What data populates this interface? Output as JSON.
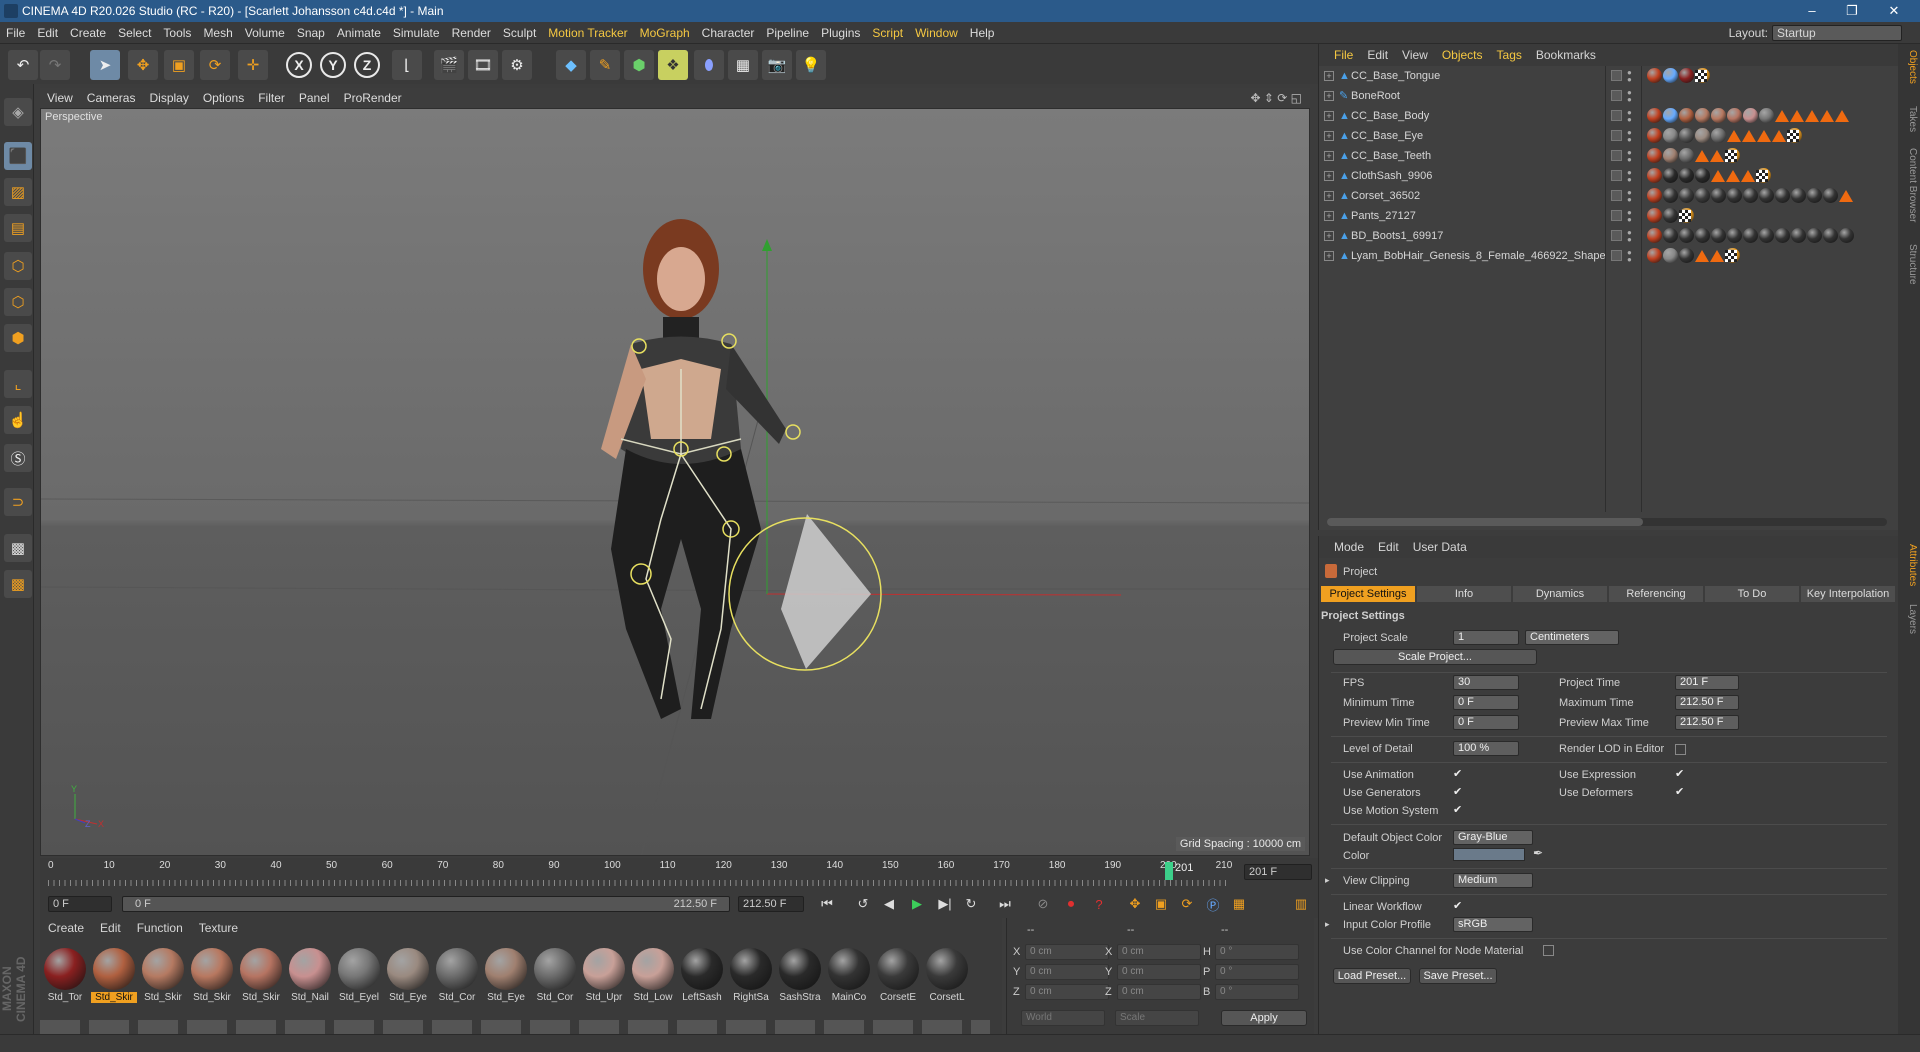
{
  "window": {
    "title": "CINEMA 4D R20.026 Studio (RC - R20) - [Scarlett Johansson c4d.c4d *] - Main"
  },
  "menu": [
    "File",
    "Edit",
    "Create",
    "Select",
    "Tools",
    "Mesh",
    "Volume",
    "Snap",
    "Animate",
    "Simulate",
    "Render",
    "Sculpt",
    "Motion Tracker",
    "MoGraph",
    "Character",
    "Pipeline",
    "Plugins",
    "Script",
    "Window",
    "Help"
  ],
  "layout": {
    "label": "Layout:",
    "value": "Startup"
  },
  "viewport": {
    "menu": [
      "View",
      "Cameras",
      "Display",
      "Options",
      "Filter",
      "Panel",
      "ProRender"
    ],
    "label": "Perspective",
    "grid_spacing": "Grid Spacing : 10000 cm",
    "axis_y": "Y",
    "axis_z": "Z",
    "axis_x": "X"
  },
  "timeline": {
    "ticks": [
      "0",
      "10",
      "20",
      "30",
      "40",
      "50",
      "60",
      "70",
      "80",
      "90",
      "100",
      "110",
      "120",
      "130",
      "140",
      "150",
      "160",
      "170",
      "180",
      "190",
      "200",
      "210"
    ],
    "current_frame": "201 F",
    "playhead_label": "201",
    "start": "0 F",
    "range_start": "0 F",
    "range_end": "212.50 F",
    "end": "212.50 F"
  },
  "materials": {
    "tabs": [
      "Create",
      "Edit",
      "Function",
      "Texture"
    ],
    "items": [
      "Std_Tor",
      "Std_Skir",
      "Std_Skir",
      "Std_Skir",
      "Std_Skir",
      "Std_Nail",
      "Std_Eyel",
      "Std_Eye",
      "Std_Cor",
      "Std_Eye",
      "Std_Cor",
      "Std_Upr",
      "Std_Low",
      "LeftSash",
      "RightSa",
      "SashStra",
      "MainCo",
      "CorsetE",
      "CorsetL"
    ],
    "colors": [
      "#8a2020",
      "#b06040",
      "#b57a62",
      "#b87860",
      "#b67462",
      "#c89090",
      "#777777",
      "#9a8a80",
      "#6c6c6c",
      "#a08070",
      "#6c6c6c",
      "#c8a098",
      "#c8a098",
      "#2a2a2a",
      "#2a2a2a",
      "#2a2a2a",
      "#333333",
      "#3a3a3a",
      "#3a3a3a"
    ]
  },
  "coords": {
    "header": [
      "--",
      "--",
      "--"
    ],
    "rows": [
      {
        "a": "X",
        "av": "0 cm",
        "b": "X",
        "bv": "0 cm",
        "c": "H",
        "cv": "0 °"
      },
      {
        "a": "Y",
        "av": "0 cm",
        "b": "Y",
        "bv": "0 cm",
        "c": "P",
        "cv": "0 °"
      },
      {
        "a": "Z",
        "av": "0 cm",
        "b": "Z",
        "bv": "0 cm",
        "c": "B",
        "cv": "0 °"
      }
    ],
    "mode": "World",
    "size_mode": "Scale",
    "apply": "Apply"
  },
  "objects": {
    "menu": [
      "File",
      "Edit",
      "View",
      "Objects",
      "Tags",
      "Bookmarks"
    ],
    "items": [
      "CC_Base_Tongue",
      "BoneRoot",
      "CC_Base_Body",
      "CC_Base_Eye",
      "CC_Base_Teeth",
      "ClothSash_9906",
      "Corset_36502",
      "Pants_27127",
      "BD_Boots1_69917",
      "Lyam_BobHair_Genesis_8_Female_466922_Shape"
    ]
  },
  "attributes": {
    "menu": [
      "Mode",
      "Edit",
      "User Data"
    ],
    "title": "Project",
    "tabs": [
      "Project Settings",
      "Info",
      "Dynamics",
      "Referencing",
      "To Do",
      "Key Interpolation"
    ],
    "section": "Project Settings",
    "project_scale_label": "Project Scale",
    "project_scale": "1",
    "project_scale_unit": "Centimeters",
    "scale_project_btn": "Scale Project...",
    "fps_label": "FPS",
    "fps": "30",
    "project_time_label": "Project Time",
    "project_time": "201 F",
    "min_time_label": "Minimum Time",
    "min_time": "0 F",
    "max_time_label": "Maximum Time",
    "max_time": "212.50 F",
    "prev_min_label": "Preview Min Time",
    "prev_min": "0 F",
    "prev_max_label": "Preview Max Time",
    "prev_max": "212.50 F",
    "lod_label": "Level of Detail",
    "lod": "100 %",
    "render_lod_label": "Render LOD in Editor",
    "use_animation": "Use Animation",
    "use_expression": "Use Expression",
    "use_generators": "Use Generators",
    "use_deformers": "Use Deformers",
    "use_motion": "Use Motion System",
    "default_color_label": "Default Object Color",
    "default_color": "Gray-Blue",
    "color_label": "Color",
    "view_clipping_label": "View Clipping",
    "view_clipping": "Medium",
    "linear_workflow": "Linear Workflow",
    "input_profile_label": "Input Color Profile",
    "input_profile": "sRGB",
    "use_color_channel": "Use Color Channel for Node Material",
    "load_preset": "Load Preset...",
    "save_preset": "Save Preset..."
  },
  "side_tabs": [
    "Objects",
    "Takes",
    "Content Browser",
    "Structure"
  ],
  "side_tabs2": [
    "Attributes",
    "Layers"
  ],
  "brand": "MAXON CINEMA 4D"
}
